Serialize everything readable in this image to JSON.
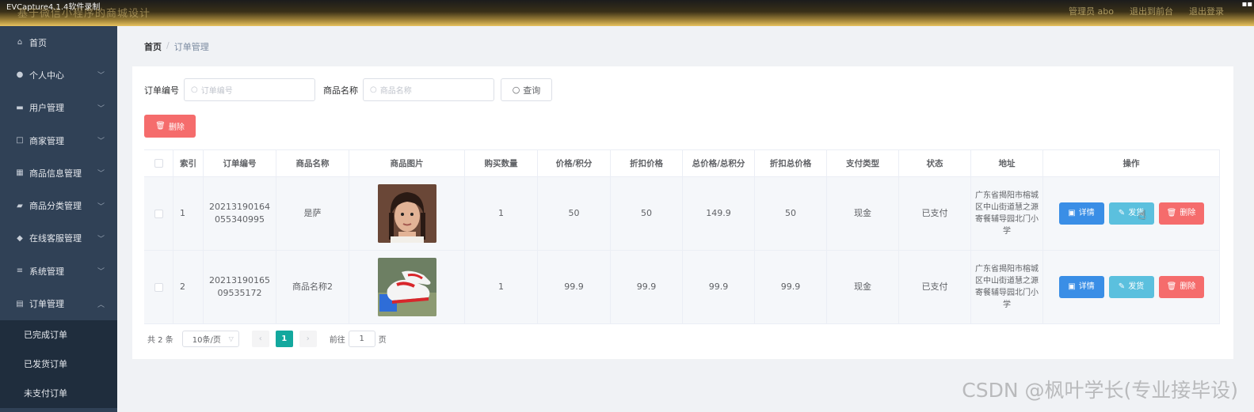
{
  "window": {
    "capture_title": "EVCapture4.1.4软件录制"
  },
  "header": {
    "app_title": "基于微信小程序的商城设计",
    "links": [
      "管理员 abo",
      "退出到前台",
      "退出登录"
    ]
  },
  "sidebar": {
    "items": [
      {
        "icon": "home-icon",
        "glyph": "⌂",
        "label": "首页",
        "expandable": false
      },
      {
        "icon": "user-icon",
        "glyph": "●",
        "label": "个人中心",
        "expandable": true
      },
      {
        "icon": "users-icon",
        "glyph": "▬",
        "label": "用户管理",
        "expandable": true
      },
      {
        "icon": "shop-icon",
        "glyph": "□",
        "label": "商家管理",
        "expandable": true
      },
      {
        "icon": "grid-icon",
        "glyph": "▦",
        "label": "商品信息管理",
        "expandable": true
      },
      {
        "icon": "message-icon",
        "glyph": "▰",
        "label": "商品分类管理",
        "expandable": true
      },
      {
        "icon": "location-icon",
        "glyph": "◆",
        "label": "在线客服管理",
        "expandable": true
      },
      {
        "icon": "menu-icon",
        "glyph": "≡",
        "label": "系统管理",
        "expandable": true
      },
      {
        "icon": "order-icon",
        "glyph": "▤",
        "label": "订单管理",
        "expandable": true,
        "open": true
      }
    ],
    "submenu": [
      "已完成订单",
      "已发货订单",
      "未支付订单"
    ]
  },
  "breadcrumb": {
    "home": "首页",
    "separator": "/",
    "current": "订单管理"
  },
  "search": {
    "order_label": "订单编号",
    "order_placeholder": "订单编号",
    "product_label": "商品名称",
    "product_placeholder": "商品名称",
    "query_button": "查询"
  },
  "toolbar": {
    "delete_label": "删除"
  },
  "table": {
    "headers": [
      "",
      "索引",
      "订单编号",
      "商品名称",
      "商品图片",
      "购买数量",
      "价格/积分",
      "折扣价格",
      "总价格/总积分",
      "折扣总价格",
      "支付类型",
      "状态",
      "地址",
      "操作"
    ],
    "rows": [
      {
        "index": "1",
        "order_no": "20213190164055340995",
        "product": "是萨",
        "image": "portrait-photo",
        "qty": "1",
        "price": "50",
        "discount_price": "50",
        "total": "149.9",
        "discount_total": "50",
        "pay_type": "现金",
        "status": "已支付",
        "address": "广东省揭阳市榕城区中山街道慧之源寄餐辅导园北门小学"
      },
      {
        "index": "2",
        "order_no": "2021319016509535172",
        "product": "商品名称2",
        "image": "sneaker-photo",
        "qty": "1",
        "price": "99.9",
        "discount_price": "99.9",
        "total": "99.9",
        "discount_total": "99.9",
        "pay_type": "现金",
        "status": "已支付",
        "address": "广东省揭阳市榕城区中山街道慧之源寄餐辅导园北门小学"
      }
    ],
    "actions": {
      "detail": "详情",
      "ship": "发货",
      "delete": "删除"
    }
  },
  "pagination": {
    "total_text": "共 2 条",
    "page_size": "10条/页",
    "current_page": "1",
    "goto_label": "前往",
    "goto_value": "1",
    "page_suffix": "页"
  },
  "watermark": "CSDN @枫叶学长(专业接毕设)",
  "colors": {
    "sidebar": "#304156",
    "accent": "#13a89e",
    "danger": "#f56c6c",
    "primary": "#3a8ee6",
    "info": "#5bc0de"
  }
}
